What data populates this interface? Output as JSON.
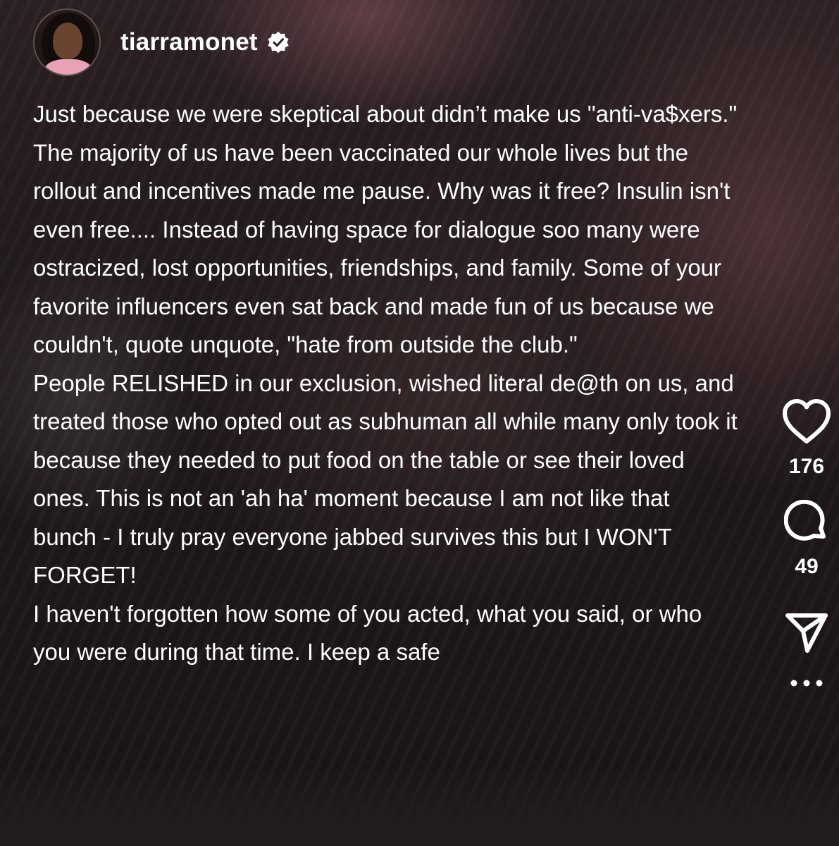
{
  "post": {
    "username": "tiarramonet",
    "verified_icon": "verified-badge-icon",
    "caption_paragraphs": [
      "Just because we were skeptical about didn’t make us \"anti-va$xers.\" The majority of us have been vaccinated our whole lives but the rollout and incentives made me pause. Why was it free? Insulin isn't even free.... Instead of having space for dialogue soo many were ostracized, lost opportunities, friendships, and family. Some of your favorite influencers even sat back and made fun of us because we couldn't, quote unquote, \"hate from outside the club.\"",
      "People RELISHED in our exclusion, wished literal de@th on us, and treated those who opted out as subhuman all while many only took it because they needed to put food on the table or see their loved ones. This is not an 'ah ha' moment because I am not like that bunch - I truly pray everyone jabbed survives this but I WON'T FORGET!",
      "I haven't forgotten how some of you acted, what you said, or who you were during that time. I keep a safe"
    ]
  },
  "actions": {
    "like_icon": "heart-icon",
    "like_count": "176",
    "comment_icon": "comment-icon",
    "comment_count": "49",
    "share_icon": "send-icon",
    "more_icon": "more-icon"
  },
  "colors": {
    "text": "#ffffff",
    "background": "#2b2022"
  }
}
